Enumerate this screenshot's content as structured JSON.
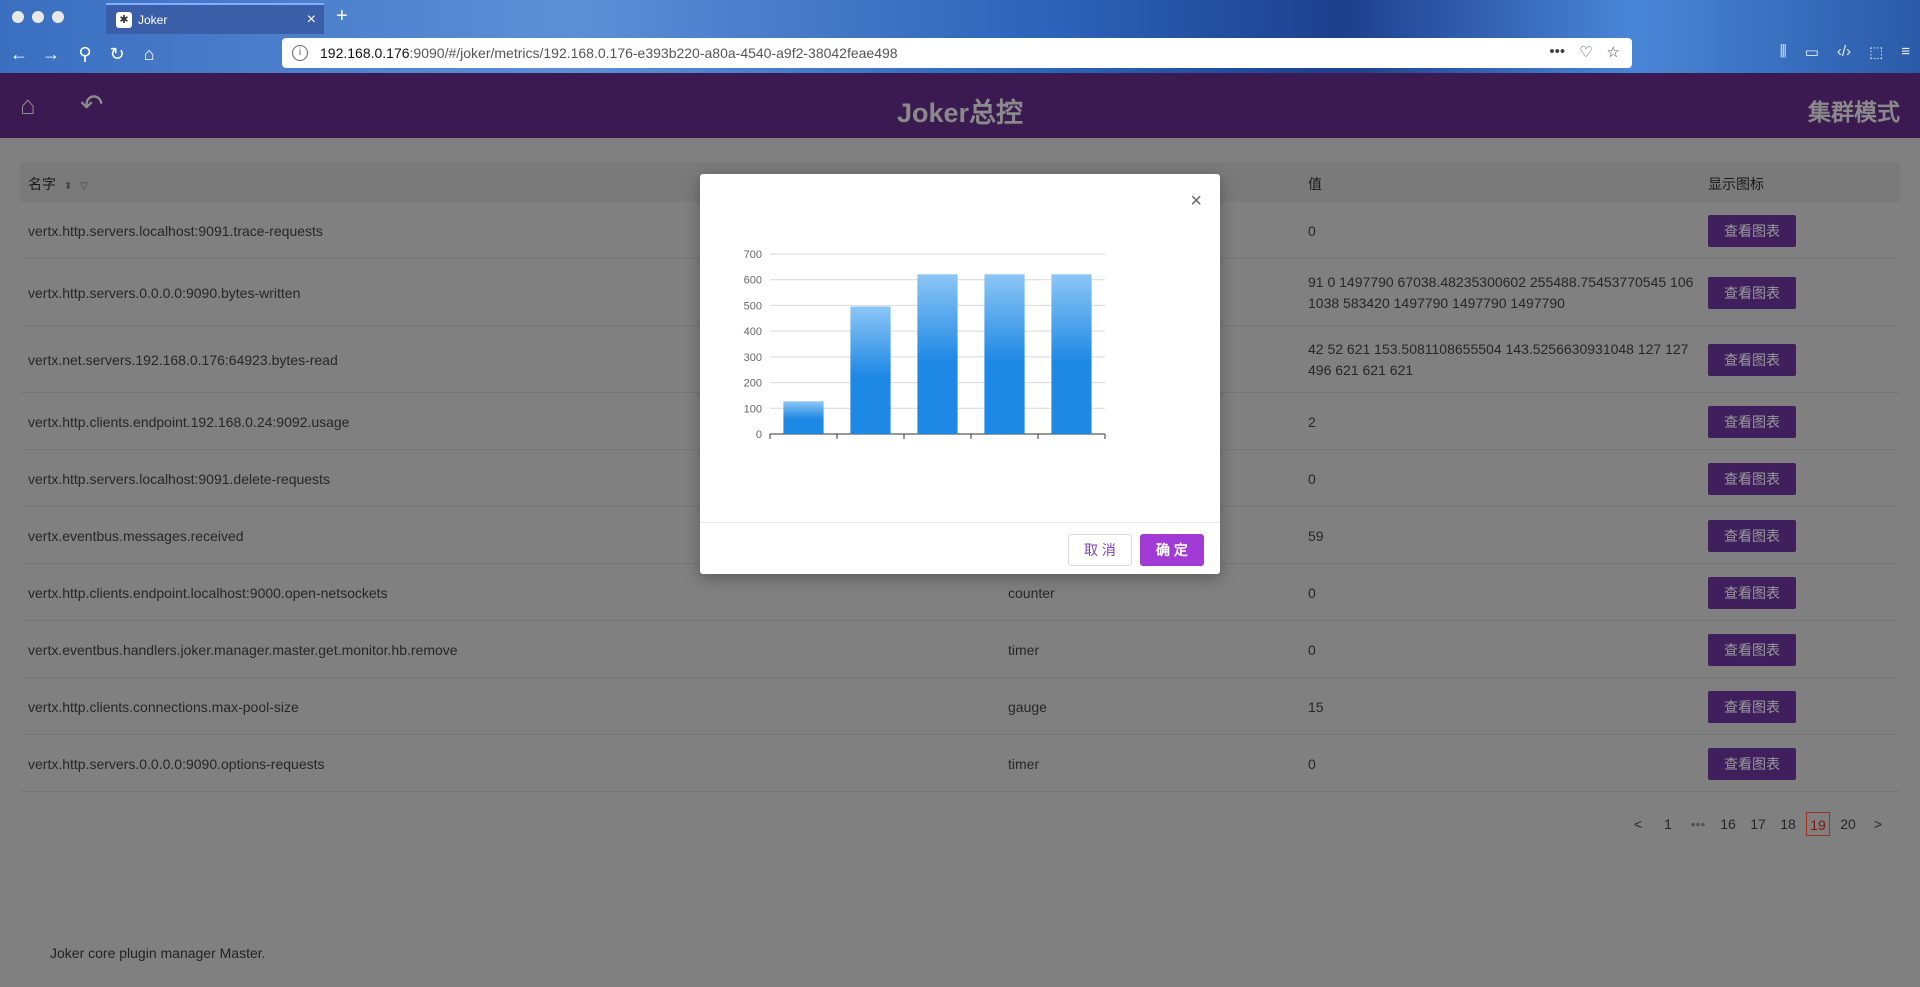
{
  "browser": {
    "tab_title": "Joker",
    "url_host": "192.168.0.176",
    "url_rest": ":9090/#/joker/metrics/192.168.0.176-e393b220-a80a-4540-a9f2-38042feae498"
  },
  "header": {
    "title": "Joker总控",
    "mode": "集群模式"
  },
  "table": {
    "columns": {
      "name": "名字",
      "value": "值",
      "chart": "显示图标"
    },
    "rows": [
      {
        "name": "vertx.http.servers.localhost:9091.trace-requests",
        "type": "",
        "value": "0",
        "button": "查看图表"
      },
      {
        "name": "vertx.http.servers.0.0.0.0:9090.bytes-written",
        "type": "",
        "value": "91 0 1497790 67038.48235300602 255488.75453770545 106 1038 583420 1497790 1497790 1497790",
        "button": "查看图表"
      },
      {
        "name": "vertx.net.servers.192.168.0.176:64923.bytes-read",
        "type": "",
        "value": "42 52 621 153.5081108655504 143.5256630931048 127 127 496 621 621 621",
        "button": "查看图表"
      },
      {
        "name": "vertx.http.clients.endpoint.192.168.0.24:9092.usage",
        "type": "",
        "value": "2",
        "button": "查看图表"
      },
      {
        "name": "vertx.http.servers.localhost:9091.delete-requests",
        "type": "",
        "value": "0",
        "button": "查看图表"
      },
      {
        "name": "vertx.eventbus.messages.received",
        "type": "",
        "value": "59",
        "button": "查看图表"
      },
      {
        "name": "vertx.http.clients.endpoint.localhost:9000.open-netsockets",
        "type": "counter",
        "value": "0",
        "button": "查看图表"
      },
      {
        "name": "vertx.eventbus.handlers.joker.manager.master.get.monitor.hb.remove",
        "type": "timer",
        "value": "0",
        "button": "查看图表"
      },
      {
        "name": "vertx.http.clients.connections.max-pool-size",
        "type": "gauge",
        "value": "15",
        "button": "查看图表"
      },
      {
        "name": "vertx.http.servers.0.0.0.0:9090.options-requests",
        "type": "timer",
        "value": "0",
        "button": "查看图表"
      }
    ]
  },
  "pagination": {
    "prev": "<",
    "next": ">",
    "ellipsis": "•••",
    "pages": [
      "1",
      "16",
      "17",
      "18",
      "19",
      "20"
    ],
    "current": "19"
  },
  "footer": "Joker core plugin manager Master.",
  "modal": {
    "close": "×",
    "cancel": "取 消",
    "ok": "确 定"
  },
  "chart_data": {
    "type": "bar",
    "categories": [
      "",
      "",
      "",
      "",
      ""
    ],
    "values": [
      127,
      496,
      621,
      621,
      621
    ],
    "ylim": [
      0,
      700
    ],
    "yticks": [
      0,
      100,
      200,
      300,
      400,
      500,
      600,
      700
    ],
    "grid": true,
    "bar_color": "#1e88e5"
  },
  "colors": {
    "header_bg": "#3a1a50",
    "button_bg": "#3f1f5c",
    "ok_bg": "#a23bd6",
    "active_page": "#a5321e"
  }
}
